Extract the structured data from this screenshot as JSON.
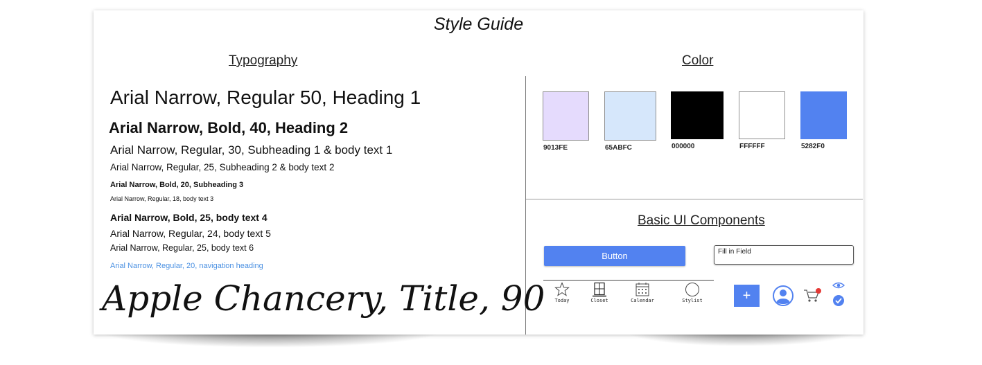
{
  "page": {
    "title": "Style Guide"
  },
  "typography": {
    "heading": "Typography",
    "samples": [
      "Arial Narrow, Regular 50, Heading 1",
      "Arial Narrow, Bold, 40, Heading 2",
      "Arial Narrow, Regular, 30, Subheading 1 & body text 1",
      "Arial Narrow, Regular, 25, Subheading 2 & body text 2",
      "Arial Narrow, Bold, 20, Subheading 3",
      "Arial Narrow, Regular, 18, body text 3",
      "Arial Narrow, Bold, 25,  body text 4",
      "Arial Narrow, Regular, 24, body text 5",
      "Arial Narrow, Regular, 25, body text 6",
      "Arial Narrow, Regular, 20, navigation heading"
    ],
    "title_sample": "Apple Chancery, Title, 90"
  },
  "color": {
    "heading": "Color",
    "swatches": [
      {
        "label": "9013FE",
        "hex": "#e5dbfd"
      },
      {
        "label": "65ABFC",
        "hex": "#d6e7fb"
      },
      {
        "label": "000000",
        "hex": "#000000"
      },
      {
        "label": "FFFFFF",
        "hex": "#ffffff"
      },
      {
        "label": "5282F0",
        "hex": "#5282f0"
      }
    ]
  },
  "components": {
    "heading": "Basic UI Components",
    "button_label": "Button",
    "field_placeholder": "Fill in Field",
    "nav": [
      {
        "label": "Today",
        "icon": "star-icon"
      },
      {
        "label": "Closet",
        "icon": "closet-icon"
      },
      {
        "label": "Calendar",
        "icon": "calendar-icon"
      },
      {
        "label": "Stylist",
        "icon": "circle-icon"
      }
    ],
    "add_symbol": "+",
    "accent": "#5282f0",
    "badge_color": "#e53935"
  }
}
